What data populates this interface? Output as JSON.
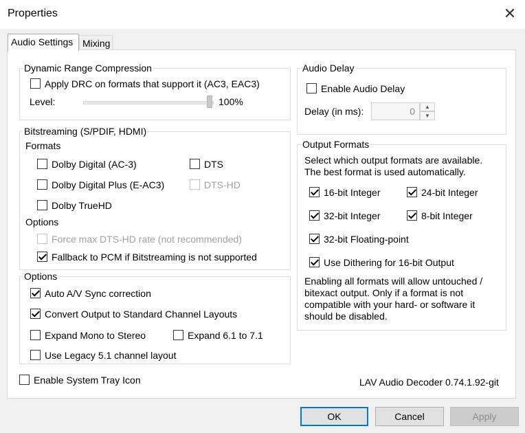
{
  "window": {
    "title": "Properties",
    "close_glyph": "✕"
  },
  "tabs": [
    "Audio Settings",
    "Mixing"
  ],
  "drc": {
    "title": "Dynamic Range Compression",
    "apply_label": "Apply DRC on formats that support it (AC3, EAC3)",
    "apply_checked": false,
    "level_label": "Level:",
    "level_value": "100%",
    "level_fraction": 1.0
  },
  "bitstreaming": {
    "title": "Bitstreaming (S/PDIF, HDMI)",
    "formats_label": "Formats",
    "formats": [
      {
        "label": "Dolby Digital (AC-3)",
        "checked": false,
        "enabled": true
      },
      {
        "label": "DTS",
        "checked": false,
        "enabled": true
      },
      {
        "label": "Dolby Digital Plus (E-AC3)",
        "checked": false,
        "enabled": true
      },
      {
        "label": "DTS-HD",
        "checked": false,
        "enabled": false
      },
      {
        "label": "Dolby TrueHD",
        "checked": false,
        "enabled": true
      }
    ],
    "options_label": "Options",
    "options": [
      {
        "label": "Force max DTS-HD rate (not recommended)",
        "checked": false,
        "enabled": false
      },
      {
        "label": "Fallback to PCM if Bitstreaming is not supported",
        "checked": true,
        "enabled": true
      }
    ]
  },
  "options": {
    "title": "Options",
    "items": [
      {
        "label": "Auto A/V Sync correction",
        "checked": true
      },
      {
        "label": "Convert Output to Standard Channel Layouts",
        "checked": true
      },
      {
        "label": "Expand Mono to Stereo",
        "checked": false
      },
      {
        "label": "Expand 6.1 to 7.1",
        "checked": false
      },
      {
        "label": "Use Legacy 5.1 channel layout",
        "checked": false
      }
    ]
  },
  "system_tray": {
    "label": "Enable System Tray Icon",
    "checked": false
  },
  "audio_delay": {
    "title": "Audio Delay",
    "enable_label": "Enable Audio Delay",
    "enable_checked": false,
    "delay_label": "Delay (in ms):",
    "delay_value": "0",
    "up_glyph": "▲",
    "down_glyph": "▼"
  },
  "output_formats": {
    "title": "Output Formats",
    "description_line1": "Select which output formats are available.",
    "description_line2": "The best format is used automatically.",
    "items": [
      {
        "label": "16-bit Integer",
        "checked": true
      },
      {
        "label": "24-bit Integer",
        "checked": true
      },
      {
        "label": "32-bit Integer",
        "checked": true
      },
      {
        "label": "8-bit Integer",
        "checked": true
      },
      {
        "label": "32-bit Floating-point",
        "checked": true
      },
      {
        "label": "Use Dithering for 16-bit Output",
        "checked": true
      }
    ],
    "note_lines": [
      "Enabling all formats will allow untouched /",
      "bitexact output. Only if a format is not",
      "compatible with your hard- or software it",
      "should be disabled."
    ]
  },
  "version": "LAV Audio Decoder 0.74.1.92-git",
  "buttons": {
    "ok": "OK",
    "cancel": "Cancel",
    "apply": "Apply"
  },
  "colors": {
    "accent": "#0078d7",
    "group_border": "#dcdcdc",
    "disabled_text": "#a0a0a0"
  }
}
